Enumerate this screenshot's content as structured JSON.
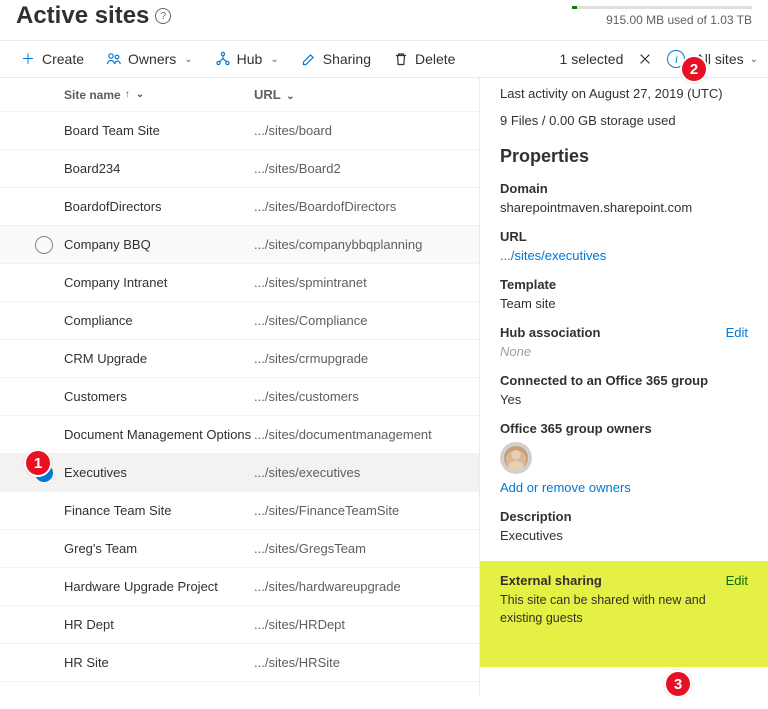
{
  "header": {
    "title": "Active sites",
    "storage_text": "915.00 MB used of 1.03 TB"
  },
  "toolbar": {
    "create": "Create",
    "owners": "Owners",
    "hub": "Hub",
    "sharing": "Sharing",
    "delete": "Delete",
    "selected": "1 selected",
    "views": "All sites"
  },
  "columns": {
    "name": "Site name",
    "url": "URL"
  },
  "rows": [
    {
      "name": "Board Team Site",
      "url": ".../sites/board"
    },
    {
      "name": "Board234",
      "url": ".../sites/Board2"
    },
    {
      "name": "BoardofDirectors",
      "url": ".../sites/BoardofDirectors"
    },
    {
      "name": "Company BBQ",
      "url": ".../sites/companybbqplanning",
      "hover": true
    },
    {
      "name": "Company Intranet",
      "url": ".../sites/spmintranet"
    },
    {
      "name": "Compliance",
      "url": ".../sites/Compliance"
    },
    {
      "name": "CRM Upgrade",
      "url": ".../sites/crmupgrade"
    },
    {
      "name": "Customers",
      "url": ".../sites/customers"
    },
    {
      "name": "Document Management Options",
      "url": ".../sites/documentmanagement"
    },
    {
      "name": "Executives",
      "url": ".../sites/executives",
      "selected": true
    },
    {
      "name": "Finance Team Site",
      "url": ".../sites/FinanceTeamSite"
    },
    {
      "name": "Greg's Team",
      "url": ".../sites/GregsTeam"
    },
    {
      "name": "Hardware Upgrade Project",
      "url": ".../sites/hardwareupgrade"
    },
    {
      "name": "HR Dept",
      "url": ".../sites/HRDept"
    },
    {
      "name": "HR Site",
      "url": ".../sites/HRSite"
    }
  ],
  "details": {
    "activity": "Last activity on August 27, 2019 (UTC)",
    "storage": "9 Files / 0.00 GB storage used",
    "section": "Properties",
    "domain_label": "Domain",
    "domain": "sharepointmaven.sharepoint.com",
    "url_label": "URL",
    "url": ".../sites/executives",
    "template_label": "Template",
    "template": "Team site",
    "hub_label": "Hub association",
    "hub": "None",
    "edit": "Edit",
    "connected_label": "Connected to an Office 365 group",
    "connected": "Yes",
    "owners_label": "Office 365 group owners",
    "owners_link": "Add or remove owners",
    "desc_label": "Description",
    "desc": "Executives",
    "ext_label": "External sharing",
    "ext_text": "This site can be shared with new and existing guests"
  },
  "badges": {
    "one": "1",
    "two": "2",
    "three": "3"
  }
}
